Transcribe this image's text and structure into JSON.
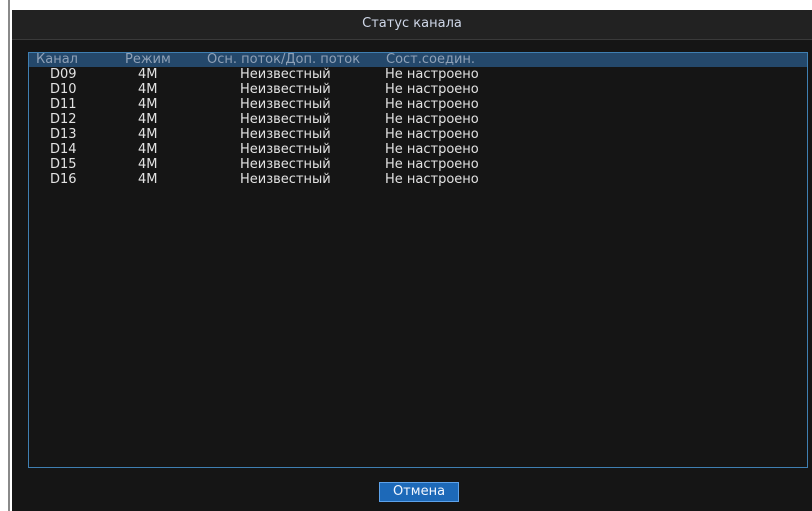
{
  "dialog": {
    "title": "Статус канала",
    "columns": [
      "Канал",
      "Режим",
      "Осн. поток/Доп. поток",
      "Сост.соедин."
    ],
    "rows": [
      {
        "channel": "D09",
        "mode": "4M",
        "stream": "Неизвестный",
        "status": "Не настроено"
      },
      {
        "channel": "D10",
        "mode": "4M",
        "stream": "Неизвестный",
        "status": "Не настроено"
      },
      {
        "channel": "D11",
        "mode": "4M",
        "stream": "Неизвестный",
        "status": "Не настроено"
      },
      {
        "channel": "D12",
        "mode": "4M",
        "stream": "Неизвестный",
        "status": "Не настроено"
      },
      {
        "channel": "D13",
        "mode": "4M",
        "stream": "Неизвестный",
        "status": "Не настроено"
      },
      {
        "channel": "D14",
        "mode": "4M",
        "stream": "Неизвестный",
        "status": "Не настроено"
      },
      {
        "channel": "D15",
        "mode": "4M",
        "stream": "Неизвестный",
        "status": "Не настроено"
      },
      {
        "channel": "D16",
        "mode": "4M",
        "stream": "Неизвестный",
        "status": "Не настроено"
      }
    ],
    "cancel_label": "Отмена"
  }
}
